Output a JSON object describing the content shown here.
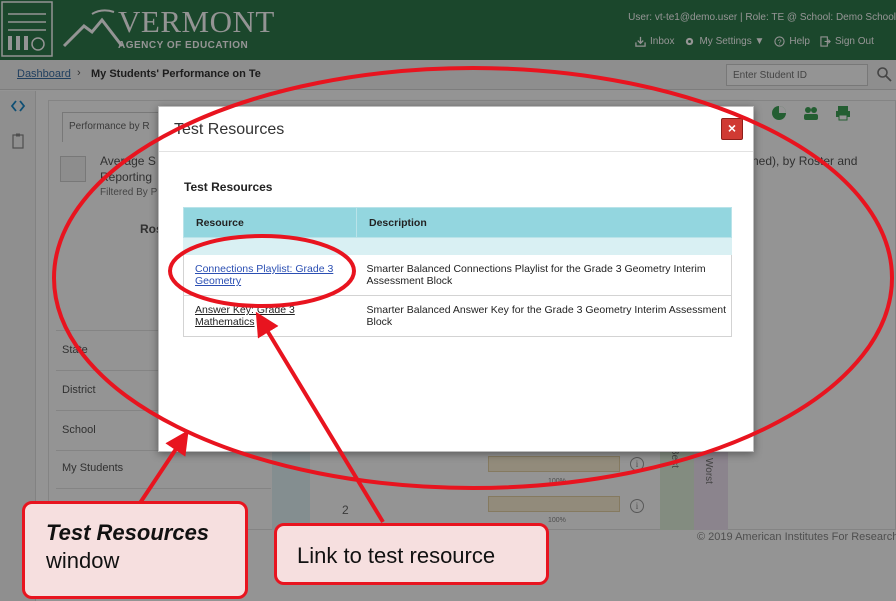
{
  "header": {
    "logo_title": "VERMONT",
    "logo_subtitle": "AGENCY OF EDUCATION",
    "user_info": "User: vt-te1@demo.user  |  Role: TE @ School: Demo School",
    "inbox_label": "Inbox",
    "settings_label": "My Settings ▼",
    "help_label": "Help",
    "signout_label": "Sign Out"
  },
  "breadcrumb": {
    "dashboard_label": "Dashboard",
    "separator": "›",
    "current_label": "My Students' Performance on Te"
  },
  "student_search": {
    "placeholder": "Enter Student ID"
  },
  "background": {
    "tab_label": "Performance by R",
    "summary_line1": "Average S",
    "summary_line2": "Reporting",
    "summary_line3": "Filtered By P",
    "summary_right": "ned), by Roster and",
    "roster_col": "Ros",
    "rows": [
      "State",
      "District",
      "School",
      "My Students"
    ],
    "rot_best": "Best",
    "rot_worst": "Worst",
    "bar_label": "100%",
    "row_number": "2",
    "info_glyph": "i",
    "footer": "© 2019 American Institutes For Research"
  },
  "modal": {
    "title": "Test Resources",
    "close_glyph": "×",
    "heading": "Test Resources",
    "table": {
      "headers": [
        "Resource",
        "Description"
      ],
      "rows": [
        {
          "resource": "Connections Playlist: Grade 3 Geometry",
          "description": "Smarter Balanced Connections Playlist for the Grade 3 Geometry Interim Assessment Block"
        },
        {
          "resource": "Answer Key: Grade 3 Mathematics",
          "description": "Smarter Balanced Answer Key for the Grade 3 Geometry Interim Assessment Block"
        }
      ]
    }
  },
  "annotations": {
    "window_callout_line1": "Test Resources",
    "window_callout_line2": "window",
    "link_callout": "Link to test resource",
    "color": "#e8141f"
  }
}
